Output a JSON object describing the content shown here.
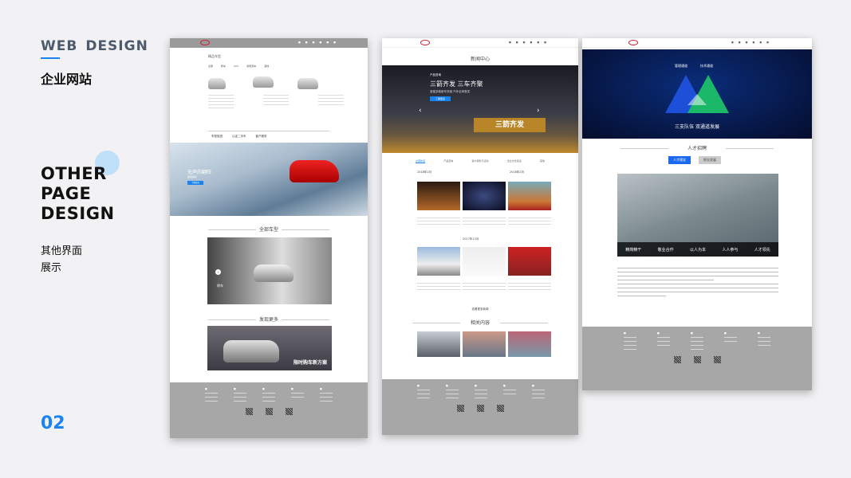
{
  "header": {
    "web_design_1": "WEB",
    "web_design_2": "DESIGN",
    "cn_title": "企业网站"
  },
  "section": {
    "line1": "OTHER",
    "line2": "PAGE",
    "line3": "DESIGN",
    "cn_line1": "其他界面",
    "cn_line2": "展示",
    "page_number": "02"
  },
  "mock1": {
    "tabs_title": "精品车型",
    "sub_tabs": [
      "全部",
      "轿车",
      "SUV",
      "新能源车",
      "其他"
    ],
    "mid_links": [
      "车型促进",
      "认证二手车",
      "客户服务"
    ],
    "banner_text": "无声的翻阵",
    "banner_sub": "越来越好",
    "banner_btn": "了解更多",
    "all_cars_title": "全部车型",
    "showroom_label": "轿车",
    "discover_title": "发现更多",
    "promo_text": "限时购车新方案"
  },
  "mock2": {
    "title": "新闻中心",
    "slide_tag": "产品咨询",
    "slide_headline": "三箭齐发 三车齐聚",
    "slide_sub": "宝骏多款新车亮相  汽车全球首发",
    "slide_btn": "了解更多",
    "slide_banner": "三箭齐发",
    "tabs": [
      "全部新闻",
      "产品咨询",
      "客户服务与活动",
      "企业文化建设",
      "其他"
    ],
    "date_1": "2018年2月",
    "date_2": "2018年2月",
    "date_3": "2017年12月",
    "more_btn": "查看更多新闻",
    "related_title": "相关内容"
  },
  "mock3": {
    "diagram_title1": "管理通道",
    "diagram_title2": "技术通道",
    "diagram_caption": "三支队伍  双通道发展",
    "recruit_title": "人才招聘",
    "btn_primary": "人才理念",
    "btn_secondary": "职业发展",
    "values": [
      "精简精干",
      "敬业合作",
      "以人为本",
      "人人参与",
      "人才领先"
    ]
  },
  "colors": {
    "accent": "#1a83f0",
    "footer": "#a7a7a7",
    "nav": "#9a9a9a"
  }
}
